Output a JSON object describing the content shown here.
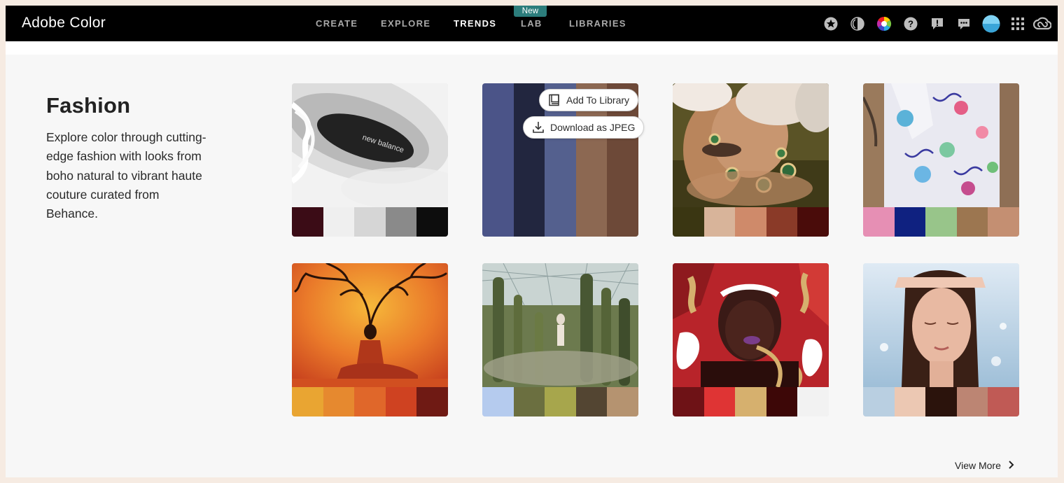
{
  "app": {
    "title": "Adobe Color"
  },
  "nav": {
    "items": [
      {
        "label": "CREATE",
        "active": false
      },
      {
        "label": "EXPLORE",
        "active": false
      },
      {
        "label": "TRENDS",
        "active": true
      },
      {
        "label": "LAB",
        "active": false,
        "badge": "New"
      },
      {
        "label": "LIBRARIES",
        "active": false
      }
    ]
  },
  "tools": [
    "favorites-star-icon",
    "accessibility-contrast-icon",
    "color-wheel-icon",
    "help-icon",
    "feedback-alert-icon",
    "chat-icon",
    "user-avatar",
    "apps-grid-icon",
    "creative-cloud-icon"
  ],
  "section": {
    "title": "Fashion",
    "description": "Explore color through cutting-edge fashion with looks from boho natural to vibrant haute couture curated from Behance."
  },
  "overlay": {
    "add_to_library": "Add To Library",
    "download_jpeg": "Download as JPEG"
  },
  "cards": [
    {
      "subject": "sneaker-photo",
      "swatches": [
        "#3b0c16",
        "#efefef",
        "#d6d6d6",
        "#8a8a8a",
        "#0d0d0d"
      ]
    },
    {
      "subject": "palette-hover",
      "swatches": [
        "#4b5488",
        "#22263f",
        "#54608e",
        "#8c6852",
        "#6d4938"
      ]
    },
    {
      "subject": "jewelry-portrait",
      "swatches": [
        "#3a3612",
        "#d8b49a",
        "#cf8a6a",
        "#8a3a28",
        "#4a0c0a"
      ]
    },
    {
      "subject": "printed-shirt",
      "swatches": [
        "#e68fb4",
        "#0f2180",
        "#98c58a",
        "#9c7650",
        "#c48f72"
      ]
    },
    {
      "subject": "orange-tree-portrait",
      "swatches": [
        "#e9a532",
        "#e6892f",
        "#e0672a",
        "#cf4221",
        "#6f1a14"
      ]
    },
    {
      "subject": "cactus-greenhouse",
      "swatches": [
        "#b5cbee",
        "#6b6f40",
        "#a7a64c",
        "#534532",
        "#b59370"
      ]
    },
    {
      "subject": "paint-portrait",
      "swatches": [
        "#6e1216",
        "#df3434",
        "#d6b06e",
        "#3d0707",
        "#f2f2f2"
      ]
    },
    {
      "subject": "woman-sunlight",
      "swatches": [
        "#b9cfe1",
        "#ecc8b3",
        "#2b130c",
        "#bc8573",
        "#c05a55"
      ]
    }
  ],
  "footer": {
    "view_more": "View More"
  }
}
